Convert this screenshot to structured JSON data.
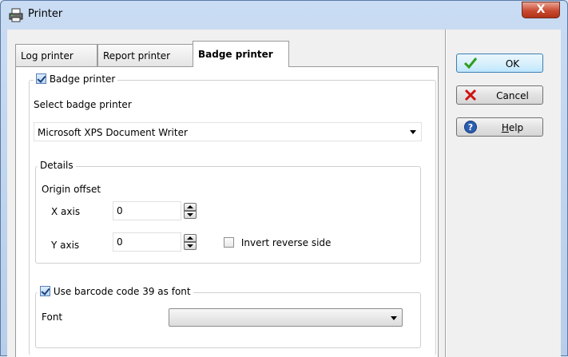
{
  "window": {
    "title": "Printer",
    "close_label": "X"
  },
  "tabs": [
    {
      "label": "Log printer",
      "active": false
    },
    {
      "label": "Report printer",
      "active": false
    },
    {
      "label": "Badge printer",
      "active": true
    }
  ],
  "badge_printer": {
    "checkbox_label": "Badge printer",
    "checked": true,
    "select_label": "Select badge printer",
    "selected_printer": "Microsoft XPS Document Writer",
    "details": {
      "legend": "Details",
      "origin_offset_label": "Origin offset",
      "x_axis_label": "X axis",
      "x_axis_value": "0",
      "y_axis_label": "Y axis",
      "y_axis_value": "0",
      "invert_label": "Invert reverse side",
      "invert_checked": false
    },
    "barcode": {
      "checkbox_label": "Use barcode code 39 as font",
      "checked": true,
      "font_label": "Font",
      "font_value": ""
    }
  },
  "buttons": {
    "ok": "OK",
    "cancel": "Cancel",
    "help_prefix": "",
    "help_underlined": "H",
    "help_rest": "elp"
  },
  "colors": {
    "ok_icon": "#2f9e1f",
    "cancel_icon": "#d01010",
    "help_icon": "#2a5db0"
  },
  "icons": {
    "title": "printer-icon",
    "ok": "checkmark-icon",
    "cancel": "x-icon",
    "help": "question-icon"
  }
}
